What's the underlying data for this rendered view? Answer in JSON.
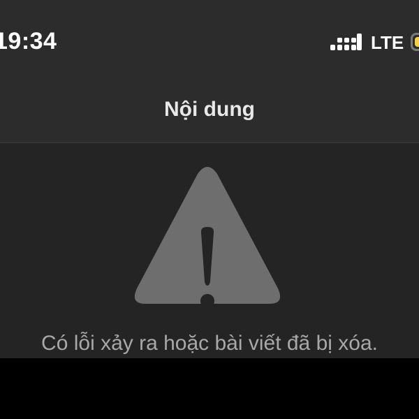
{
  "status_bar": {
    "time": "19:34",
    "network": "LTE",
    "signal_icon": "signal-bars-icon",
    "battery_icon": "battery-icon",
    "battery_color": "#f5d142"
  },
  "nav": {
    "title": "Nội dung"
  },
  "content": {
    "icon": "warning-triangle-icon",
    "icon_color": "#6e6e6e",
    "message": "Có lỗi xảy ra hoặc bài viết đã bị xóa."
  }
}
